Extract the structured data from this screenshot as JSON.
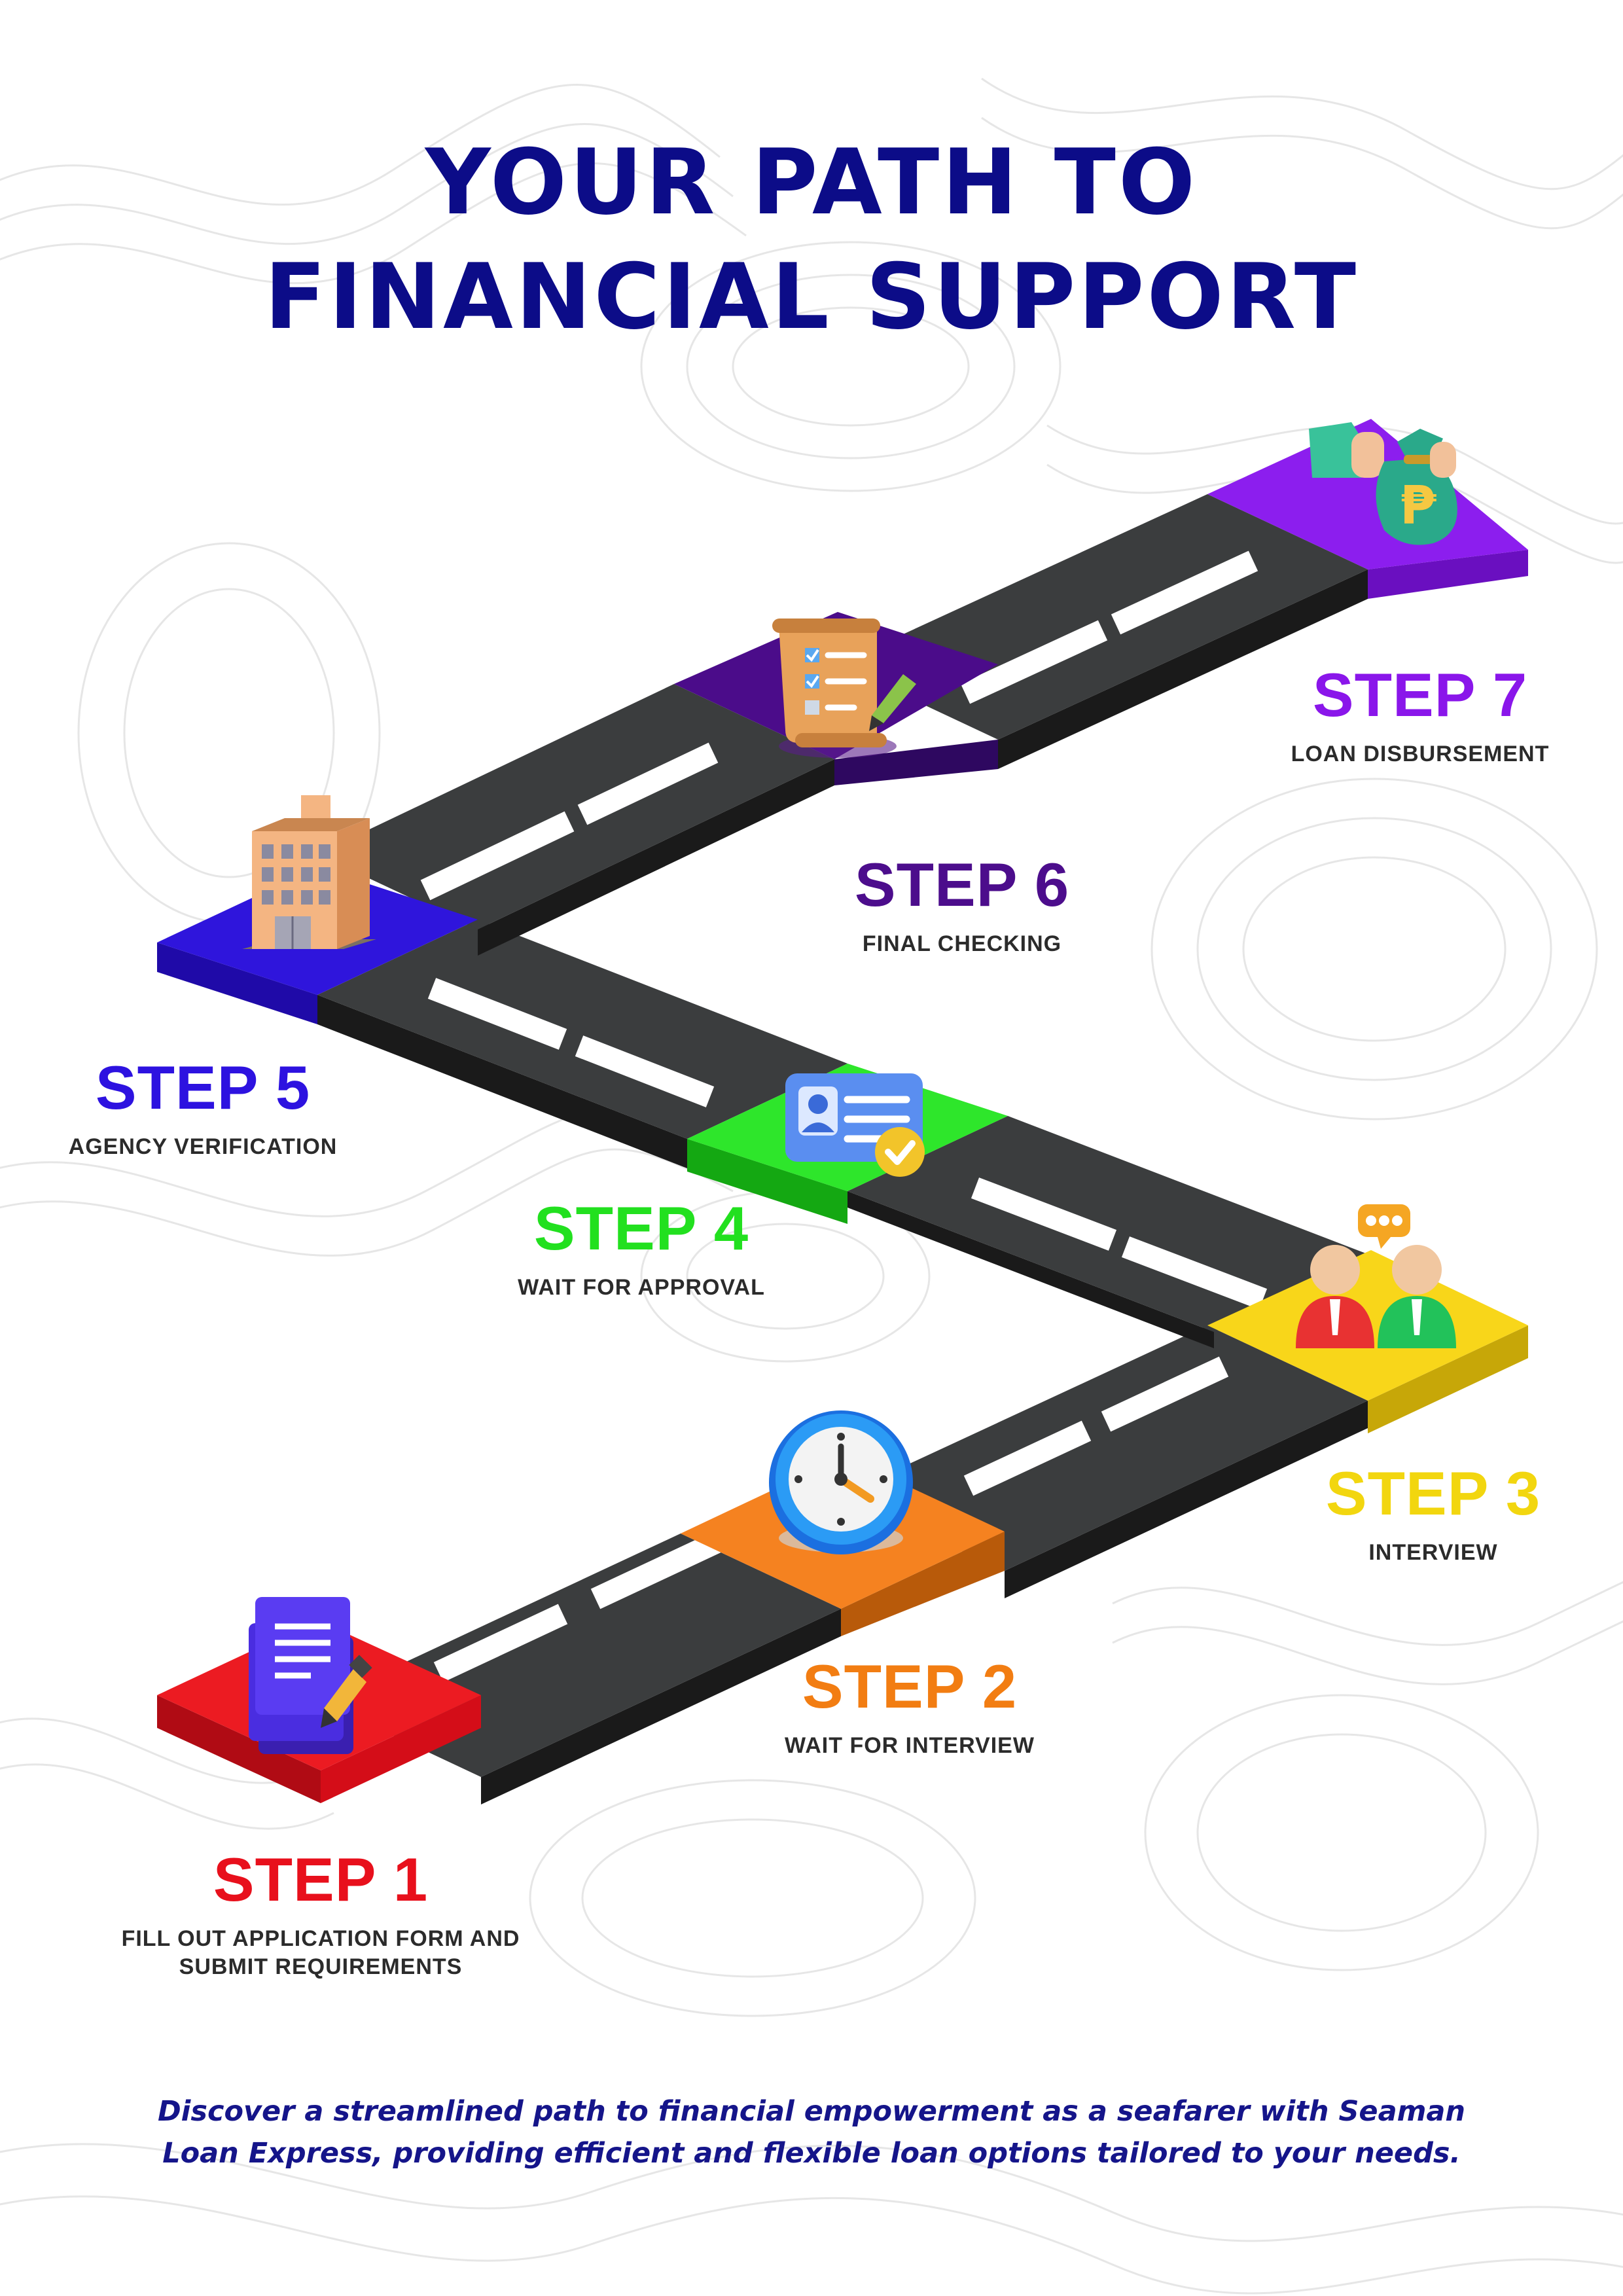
{
  "title": {
    "line1": "YOUR PATH TO",
    "line2": "FINANCIAL SUPPORT"
  },
  "steps": [
    {
      "label": "STEP 1",
      "description": "FILL OUT APPLICATION FORM AND SUBMIT REQUIREMENTS",
      "color": "#e8101c",
      "icon": "document-pencil-icon"
    },
    {
      "label": "STEP 2",
      "description": "WAIT FOR INTERVIEW",
      "color": "#f27d12",
      "icon": "clock-icon"
    },
    {
      "label": "STEP 3",
      "description": "INTERVIEW",
      "color": "#f2d60f",
      "icon": "people-chat-icon"
    },
    {
      "label": "STEP 4",
      "description": "WAIT FOR APPROVAL",
      "color": "#22e01f",
      "icon": "id-card-check-icon"
    },
    {
      "label": "STEP 5",
      "description": "AGENCY VERIFICATION",
      "color": "#2d12e0",
      "icon": "building-icon"
    },
    {
      "label": "STEP 6",
      "description": "FINAL CHECKING",
      "color": "#4c0d8c",
      "icon": "checklist-scroll-icon"
    },
    {
      "label": "STEP 7",
      "description": "LOAN DISBURSEMENT",
      "color": "#8a16ea",
      "icon": "money-bag-hand-icon"
    }
  ],
  "footer": {
    "line1": "Discover a streamlined path to financial empowerment as a seafarer with Seaman",
    "line2": "Loan Express, providing efficient and flexible loan options tailored to your needs."
  }
}
